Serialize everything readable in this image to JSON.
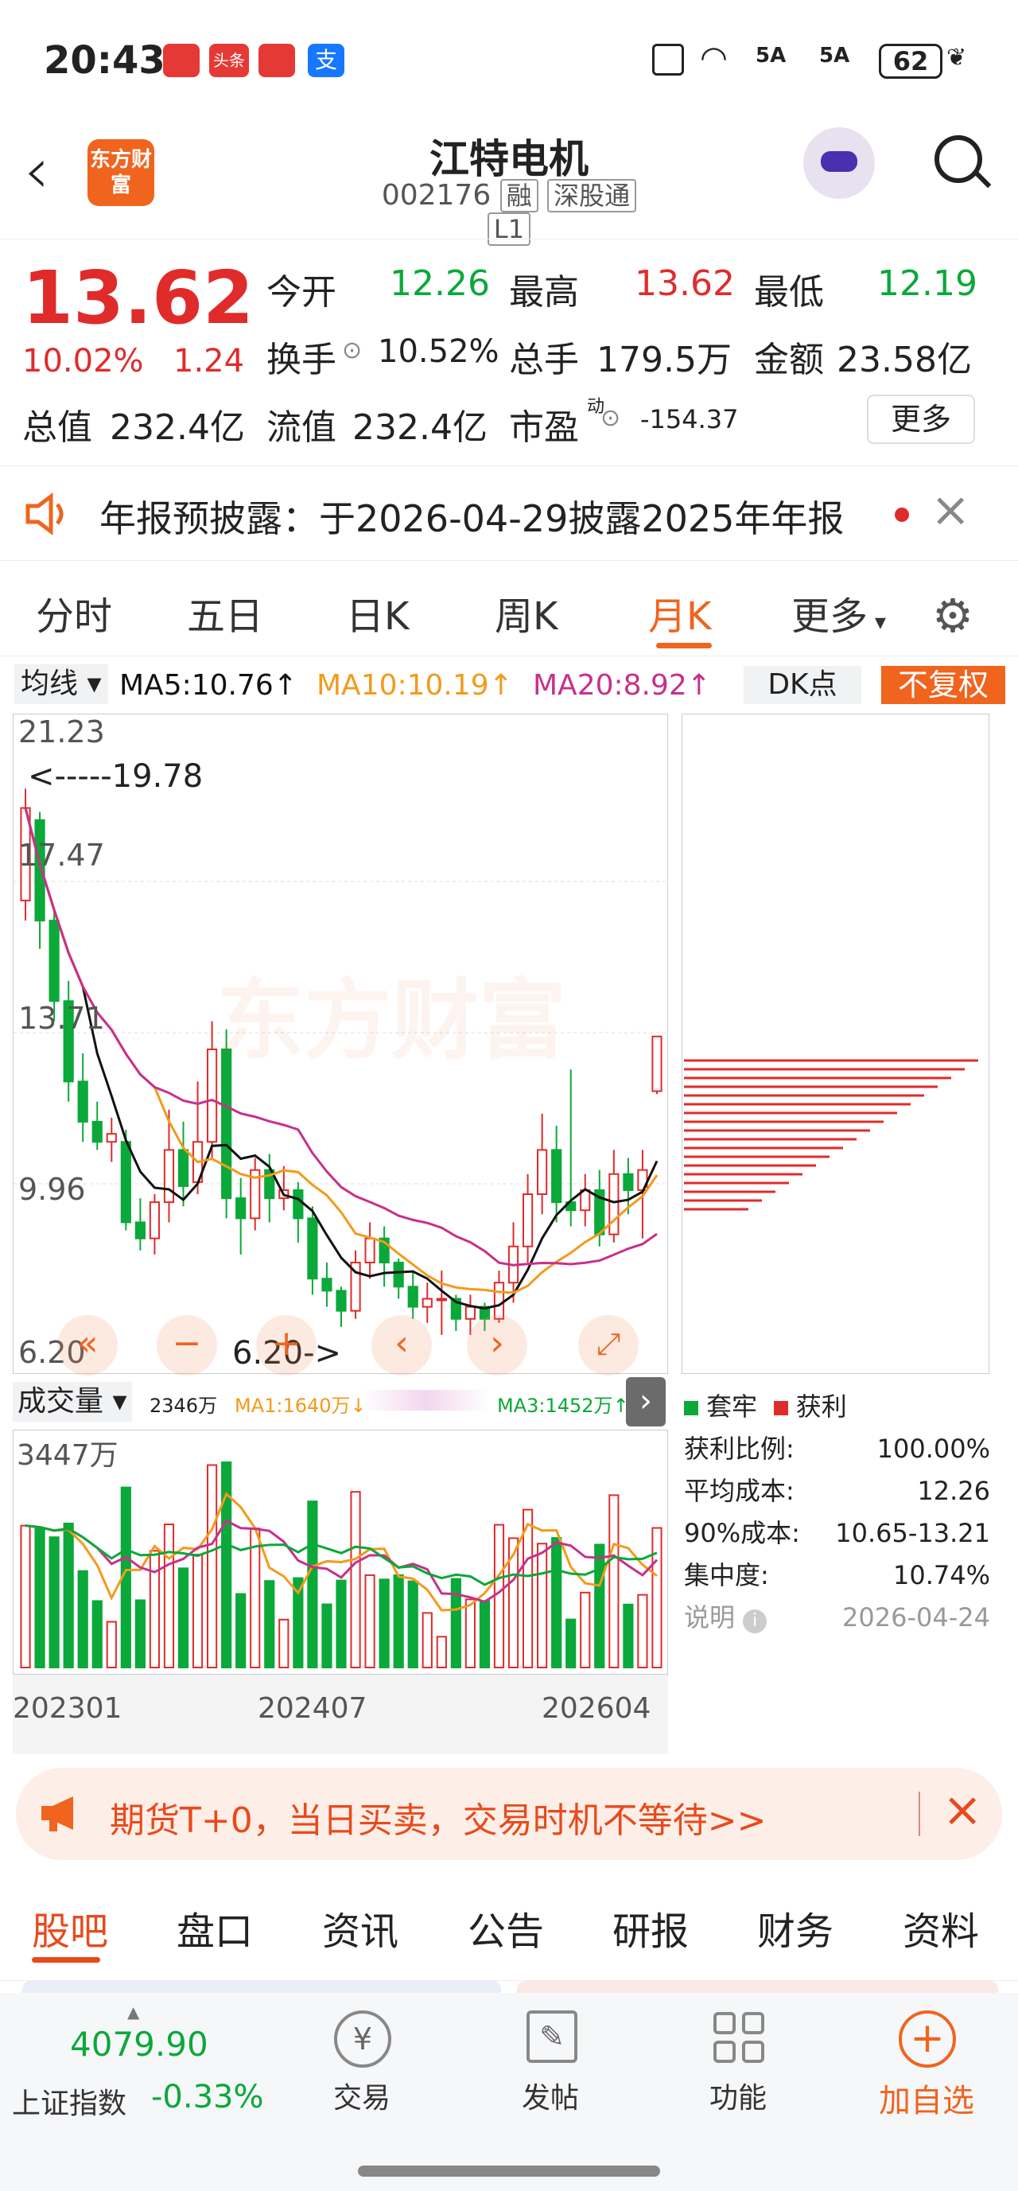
{
  "status": {
    "time": "20:43",
    "battery": "62",
    "net1": "5A",
    "net2": "5A"
  },
  "header": {
    "brand": "东方财富",
    "title": "江特电机",
    "code": "002176",
    "tag1": "融",
    "tag2": "深股通",
    "tag3": "L1"
  },
  "quote": {
    "price": "13.62",
    "pct": "10.02%",
    "chg": "1.24",
    "open_label": "今开",
    "open": "12.26",
    "high_label": "最高",
    "high": "13.62",
    "low_label": "最低",
    "low": "12.19",
    "turn_label": "换手",
    "turn": "10.52%",
    "vol_label": "总手",
    "vol": "179.5万",
    "amt_label": "金额",
    "amt": "23.58亿",
    "mcap_label": "总值",
    "mcap": "232.4亿",
    "float_label": "流值",
    "float": "232.4亿",
    "pe_label": "市盈",
    "pe_sup": "动",
    "pe": "-154.37",
    "more": "更多"
  },
  "notice": {
    "text": "年报预披露：于2026-04-29披露2025年年报"
  },
  "tabs": [
    "分时",
    "五日",
    "日K",
    "周K",
    "月K",
    "更多"
  ],
  "active_tab": "月K",
  "ma": {
    "type": "均线",
    "ma5": "MA5:10.76",
    "ma10": "MA10:10.19",
    "ma20": "MA20:8.92",
    "dk": "DK点",
    "fq": "不复权"
  },
  "price_axis": {
    "t1": "21.23",
    "t2": "17.47",
    "t3": "13.71",
    "t4": "9.96",
    "t5": "6.20",
    "hi": "<-----19.78",
    "lo": "6.20->"
  },
  "vol": {
    "label": "成交量",
    "v": "2346万",
    "ma1": "MA1:1640万",
    "ma3": "MA3:1452万",
    "axis": "3447万"
  },
  "dates": [
    "202301",
    "202407",
    "202604"
  ],
  "chip": {
    "legend1": "套牢",
    "legend2": "获利",
    "rows": [
      {
        "k": "获利比例:",
        "v": "100.00%"
      },
      {
        "k": "平均成本:",
        "v": "12.26"
      },
      {
        "k": "90%成本:",
        "v": "10.65-13.21"
      },
      {
        "k": "集中度:",
        "v": "10.74%"
      }
    ],
    "note": "说明",
    "date": "2026-04-24"
  },
  "promo": {
    "text": "期货T+0，当日买卖，交易时机不等待>>"
  },
  "bottom_tabs": [
    "股吧",
    "盘口",
    "资讯",
    "公告",
    "研报",
    "财务",
    "资料"
  ],
  "bar": {
    "index": "4079.90",
    "index_name": "上证指数",
    "index_pct": "-0.33%",
    "trade": "交易",
    "post": "发帖",
    "func": "功能",
    "add": "加自选"
  },
  "colors": {
    "up": "#e02b2b",
    "down": "#0ba83a",
    "accent": "#f0641e",
    "ma5": "#111111",
    "ma10": "#f39a1b",
    "ma20": "#c8308a"
  },
  "chart_data": {
    "type": "candlestick",
    "ylim": [
      6.2,
      21.23
    ],
    "candles": [
      [
        17,
        19.3,
        16.5,
        19.78
      ],
      [
        19,
        16.5,
        15.8,
        19.2
      ],
      [
        16.5,
        14.5,
        14,
        16.8
      ],
      [
        14.5,
        12.5,
        12,
        15
      ],
      [
        12.5,
        11.5,
        11,
        13.2
      ],
      [
        11.5,
        11,
        10.8,
        12
      ],
      [
        11,
        11.2,
        10.5,
        11.6
      ],
      [
        11,
        9,
        8.8,
        11.3
      ],
      [
        9,
        8.6,
        8.3,
        9.6
      ],
      [
        8.6,
        9.5,
        8.2,
        9.7
      ],
      [
        9.5,
        10.8,
        9,
        11.8
      ],
      [
        10.8,
        9.9,
        9.4,
        11.5
      ],
      [
        10,
        11,
        9.7,
        12.5
      ],
      [
        11,
        13.3,
        10.6,
        14
      ],
      [
        13.3,
        9.6,
        9.1,
        13.8
      ],
      [
        9.6,
        9.1,
        8.2,
        10.1
      ],
      [
        9.1,
        10.3,
        8.8,
        10.6
      ],
      [
        10.3,
        9.6,
        9,
        10.7
      ],
      [
        9.6,
        9.8,
        9.3,
        10.4
      ],
      [
        9.8,
        9.1,
        8.5,
        10
      ],
      [
        9.1,
        7.6,
        7.2,
        9.4
      ],
      [
        7.6,
        7.3,
        6.9,
        8
      ],
      [
        7.3,
        6.8,
        6.4,
        7.4
      ],
      [
        6.8,
        8,
        6.6,
        8.3
      ],
      [
        8,
        8.6,
        7.6,
        9
      ],
      [
        8.6,
        8,
        7.4,
        8.9
      ],
      [
        8,
        7.4,
        7.1,
        8.1
      ],
      [
        7.4,
        6.9,
        6.6,
        7.8
      ],
      [
        6.9,
        7.1,
        6.5,
        7.5
      ],
      [
        7.1,
        7.1,
        6.2,
        7.8
      ],
      [
        7.1,
        6.6,
        6.3,
        7.2
      ],
      [
        6.6,
        6.9,
        6.2,
        7.2
      ],
      [
        6.9,
        6.6,
        6.3,
        7
      ],
      [
        6.6,
        7.5,
        6.5,
        7.8
      ],
      [
        7.5,
        8.4,
        7,
        9
      ],
      [
        8.4,
        9.7,
        8,
        10.2
      ],
      [
        9.7,
        10.8,
        9.2,
        11.7
      ],
      [
        10.8,
        9.5,
        9,
        11.4
      ],
      [
        9.5,
        9.3,
        8.9,
        12.8
      ],
      [
        9.3,
        9.8,
        8.9,
        10.2
      ],
      [
        9.8,
        8.7,
        8.4,
        10.3
      ],
      [
        8.7,
        10.2,
        8.5,
        10.8
      ],
      [
        10.2,
        9.8,
        9.2,
        10.6
      ],
      [
        9.8,
        10.3,
        8.6,
        10.8
      ],
      [
        12.26,
        13.62,
        12.19,
        13.62
      ]
    ]
  }
}
